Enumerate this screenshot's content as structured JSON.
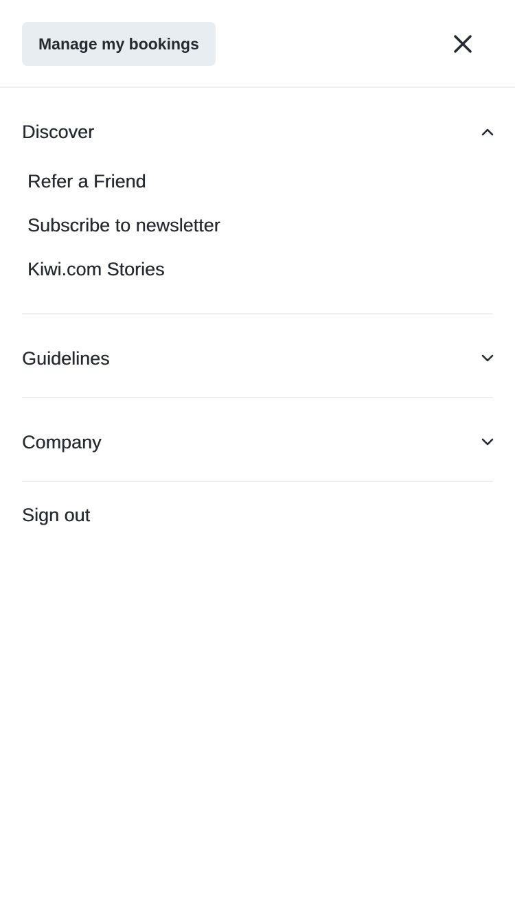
{
  "header": {
    "manage_bookings_label": "Manage my bookings",
    "close_icon": "close-icon"
  },
  "menu": {
    "discover": {
      "title": "Discover",
      "expanded": true,
      "icon": "chevron-up-icon",
      "items": [
        {
          "label": "Refer a Friend"
        },
        {
          "label": "Subscribe to newsletter"
        },
        {
          "label": "Kiwi.com Stories"
        }
      ]
    },
    "guidelines": {
      "title": "Guidelines",
      "expanded": false,
      "icon": "chevron-down-icon"
    },
    "company": {
      "title": "Company",
      "expanded": false,
      "icon": "chevron-down-icon"
    },
    "sign_out_label": "Sign out"
  },
  "colors": {
    "text": "#252a31",
    "button_bg": "#e8edf1",
    "divider": "#eef1f3",
    "background": "#ffffff"
  }
}
